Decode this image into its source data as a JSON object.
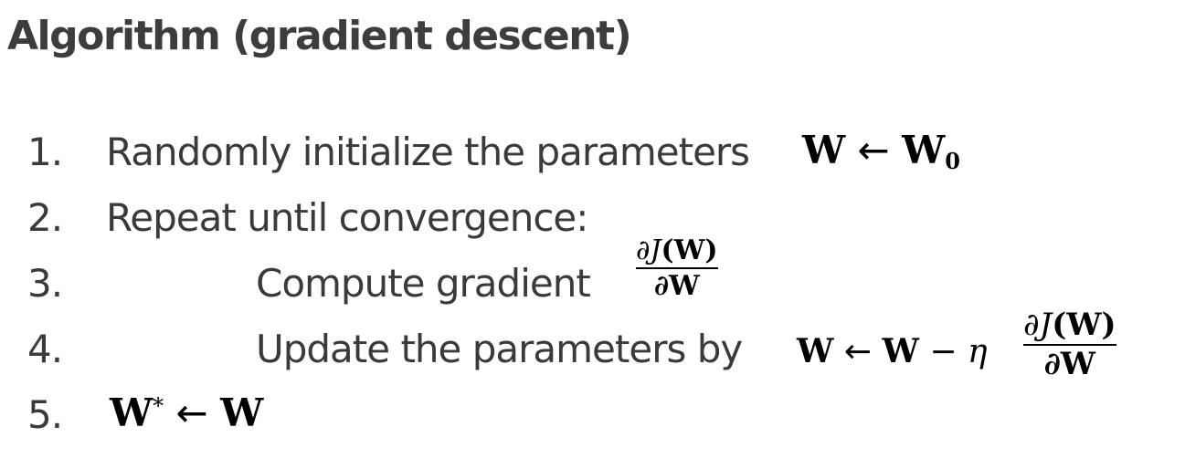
{
  "title": "Algorithm (gradient descent)",
  "steps": [
    {
      "num": "1.",
      "text": "Randomly initialize the parameters"
    },
    {
      "num": "2.",
      "text": "Repeat until convergence:"
    },
    {
      "num": "3.",
      "text": "Compute gradient"
    },
    {
      "num": "4.",
      "text": "Update the parameters by"
    },
    {
      "num": "5.",
      "text": ""
    }
  ],
  "math": {
    "step1": {
      "lhs": "W",
      "arrow": "←",
      "rhs": "W",
      "rhs_sub": "0"
    },
    "step3": {
      "partial": "∂",
      "script_j": "J",
      "arg": "(W)",
      "den": "∂W"
    },
    "step4": {
      "lhs": "W",
      "arrow": "←",
      "w": "W",
      "minus": "−",
      "eta": "η",
      "partial": "∂",
      "script_j": "J",
      "arg": "(W)",
      "den": "∂W"
    },
    "step5": {
      "lhs": "W",
      "star": "*",
      "arrow": "←",
      "rhs": "W"
    }
  }
}
